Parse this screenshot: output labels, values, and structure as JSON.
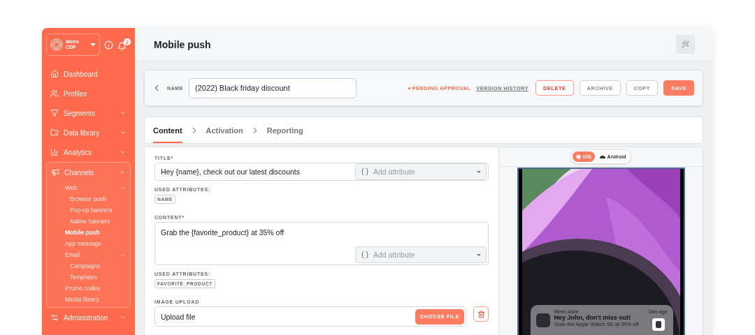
{
  "sidebar": {
    "brand": [
      "Meiro",
      "CDP"
    ],
    "notification_count": "2",
    "nav": [
      {
        "label": "Dashboard",
        "selected": false
      },
      {
        "label": "Profiles",
        "selected": false
      },
      {
        "label": "Segments",
        "selected": false,
        "expanded": false
      },
      {
        "label": "Data library",
        "selected": false,
        "expanded": false
      },
      {
        "label": "Analytics",
        "selected": false,
        "expanded": false
      },
      {
        "label": "Channels",
        "selected": false,
        "expanded": true,
        "children": [
          {
            "label": "Web",
            "selected": false,
            "expanded": true,
            "children": [
              {
                "label": "Browser push",
                "selected": false
              },
              {
                "label": "Pop-up banners",
                "selected": false
              },
              {
                "label": "Native banners",
                "selected": false
              }
            ]
          },
          {
            "label": "Mobile push",
            "selected": true
          },
          {
            "label": "App message",
            "selected": false
          },
          {
            "label": "Email",
            "selected": false,
            "expanded": true,
            "children": [
              {
                "label": "Campaigns",
                "selected": false
              },
              {
                "label": "Templates",
                "selected": false
              }
            ]
          },
          {
            "label": "Promo codes",
            "selected": false
          },
          {
            "label": "Media library",
            "selected": false
          }
        ]
      },
      {
        "label": "Administration",
        "selected": false,
        "expanded": false
      }
    ]
  },
  "header": {
    "title": "Mobile push"
  },
  "name_bar": {
    "label": "NAME",
    "value": "(2022) Black friday discount",
    "status": "PENDING APPROVAL",
    "history_link": "VERSION HISTORY",
    "buttons": [
      {
        "label": "DELETE",
        "kind": "danger"
      },
      {
        "label": "ARCHIVE",
        "kind": "default"
      },
      {
        "label": "COPY",
        "kind": "default"
      },
      {
        "label": "SAVE",
        "kind": "primary"
      }
    ]
  },
  "tabs": [
    {
      "label": "Content",
      "selected": true
    },
    {
      "label": "Activation",
      "selected": false
    },
    {
      "label": "Reporting",
      "selected": false
    }
  ],
  "form": [
    {
      "kind": "input",
      "label": "TITLE*",
      "value": "Hey {name}, check out our latest discounts",
      "attribute_placeholder": "Add attribute",
      "used_label": "USED ATTRIBUTES:",
      "attributes": [
        "NAME"
      ]
    },
    {
      "kind": "textarea",
      "label": "CONTENT*",
      "value": "Grab the {favorite_product} at 35% off",
      "attribute_placeholder": "Add attribute",
      "used_label": "USED ATTRIBUTES:",
      "attributes": [
        "FAVORITE_PRODUCT"
      ]
    },
    {
      "kind": "upload",
      "label": "IMAGE UPLOAD",
      "value": "Upload file",
      "button": "CHOOSE FILE"
    }
  ],
  "preview": {
    "platforms": [
      {
        "label": "iOS",
        "selected": true
      },
      {
        "label": "Android",
        "selected": false
      }
    ],
    "notification": {
      "app": "Meiro.store",
      "time": "34m ago",
      "title": "Hey John, don't miss out!",
      "body": "Grab the Apple Watch SE at 35% off"
    }
  }
}
